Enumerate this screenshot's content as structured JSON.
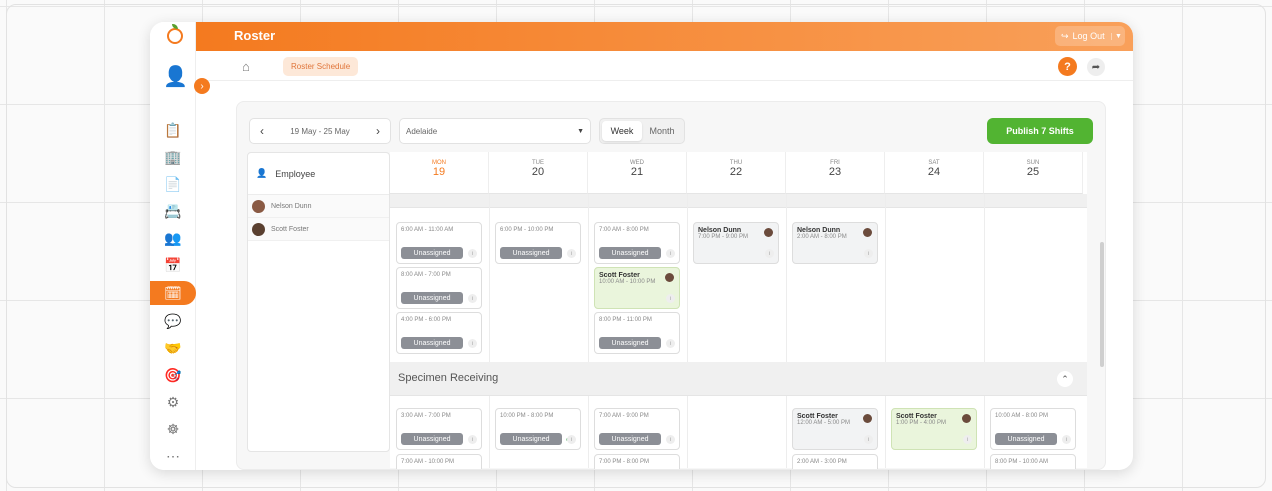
{
  "app": {
    "title": "Roster",
    "logout": "Log Out"
  },
  "breadcrumb": {
    "current": "Roster Schedule"
  },
  "toolbar": {
    "date_range": "19 May - 25 May",
    "location": "Adelaide",
    "view_week": "Week",
    "view_month": "Month",
    "publish": "Publish 7 Shifts"
  },
  "employees": {
    "header": "Employee",
    "rows": [
      "Nelson Dunn",
      "Scott Foster"
    ]
  },
  "days": [
    {
      "dow": "MON",
      "date": "19"
    },
    {
      "dow": "TUE",
      "date": "20"
    },
    {
      "dow": "WED",
      "date": "21"
    },
    {
      "dow": "THU",
      "date": "22"
    },
    {
      "dow": "FRI",
      "date": "23"
    },
    {
      "dow": "SAT",
      "date": "24"
    },
    {
      "dow": "SUN",
      "date": "25"
    }
  ],
  "sections": {
    "second": "Specimen Receiving"
  },
  "shifts": {
    "unassigned": "Unassigned",
    "mon": [
      "6:00 AM - 11:00 AM",
      "8:00 AM - 7:00 PM",
      "4:00 PM - 6:00 PM"
    ],
    "tue": [
      "6:00 PM - 10:00 PM"
    ],
    "wed": [
      "7:00 AM - 8:00 PM",
      "8:00 PM - 11:00 PM"
    ],
    "wed_named": {
      "name": "Scott Foster",
      "time": "10:00 AM - 10:00 PM"
    },
    "thu_named": {
      "name": "Nelson Dunn",
      "time": "7:00 PM - 9:00 PM"
    },
    "fri_named": {
      "name": "Nelson Dunn",
      "time": "2:00 AM - 8:00 PM"
    },
    "s2_mon": [
      "3:00 AM - 7:00 PM",
      "7:00 AM - 10:00 PM"
    ],
    "s2_tue": [
      "10:00 PM - 8:00 PM"
    ],
    "s2_wed": [
      "7:00 AM - 9:00 PM",
      "7:00 PM - 8:00 PM"
    ],
    "s2_fri": {
      "name": "Scott Foster",
      "time": "12:00 AM - 5:00 PM",
      "extra": "2:00 AM - 3:00 PM"
    },
    "s2_sat": {
      "name": "Scott Foster",
      "time": "1:00 PM - 4:00 PM"
    },
    "s2_sun": [
      "10:00 AM - 8:00 PM",
      "8:00 PM - 10:00 AM"
    ]
  },
  "colors": {
    "accent": "#f47a1f",
    "publish": "#52b432",
    "unassigned": "#8c8f96"
  }
}
